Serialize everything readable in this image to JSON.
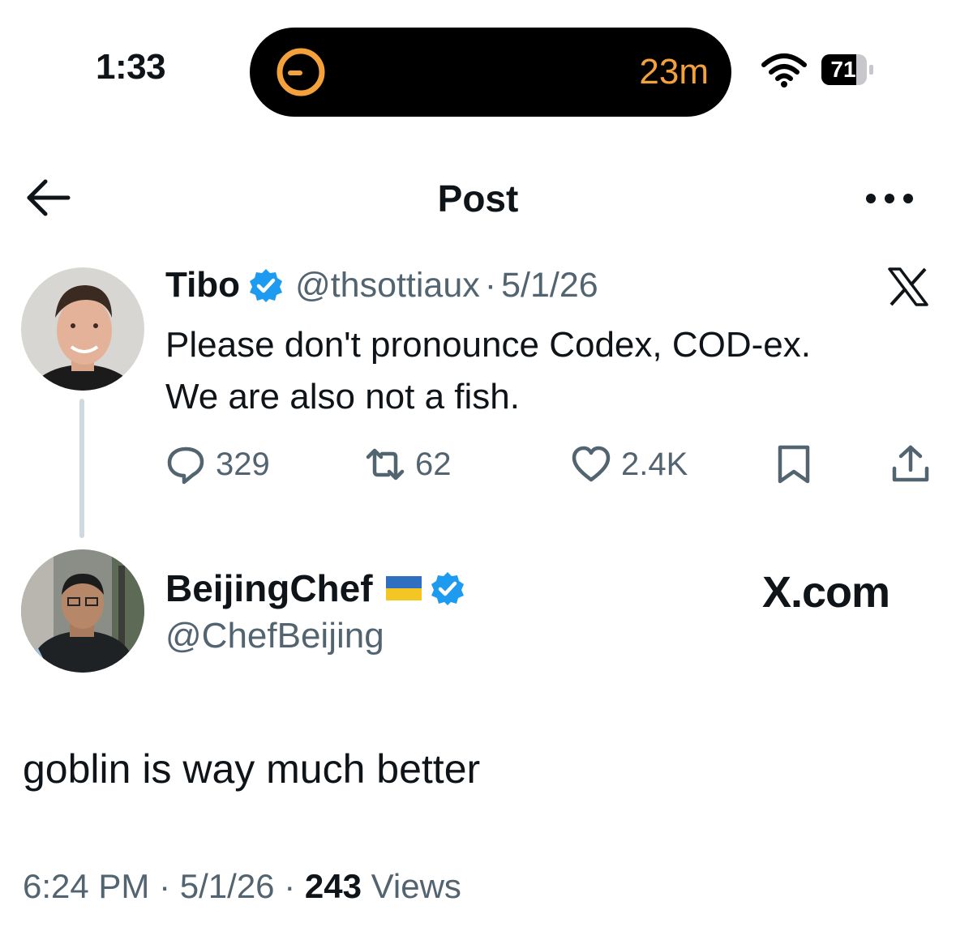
{
  "status_bar": {
    "time": "1:33",
    "island_timer": "23m",
    "battery_percent": "71",
    "accent_color": "#f5a13b",
    "icons": [
      "timer-icon",
      "wifi-icon",
      "battery-icon"
    ]
  },
  "nav": {
    "title": "Post",
    "back_icon": "arrow-left-icon",
    "more_icon": "ellipsis-icon"
  },
  "quoted_post": {
    "name": "Tibo",
    "handle": "@thsottiaux",
    "separator": "·",
    "date": "5/1/26",
    "verified": true,
    "text_line1": "Please don't pronounce Codex, COD-ex.",
    "text_line2": "We are also not a fish.",
    "replies": "329",
    "reposts": "62",
    "likes": "2.4K",
    "source_icon": "x-logo-icon"
  },
  "post": {
    "name": "BeijingChef",
    "flag": "ukraine-flag-icon",
    "verified": true,
    "handle": "@ChefBeijing",
    "source_label": "X.com",
    "text": "goblin is way much better",
    "time": "6:24 PM",
    "separator": "·",
    "date": "5/1/26",
    "views": "243",
    "views_label": "Views"
  },
  "colors": {
    "text": "#0f1419",
    "secondary": "#536471",
    "verified": "#1d9bf0",
    "thread_line": "#cfd9de"
  }
}
